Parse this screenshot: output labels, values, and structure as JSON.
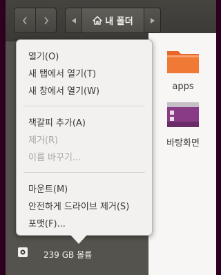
{
  "toolbar": {
    "back_icon": "chevron-left",
    "forward_icon": "chevron-right",
    "path_prev_icon": "triangle-left",
    "path_next_icon": "triangle-right",
    "home_icon": "home",
    "current_folder": "내 폴더"
  },
  "context_menu": {
    "group1": [
      {
        "label": "열기(O)",
        "enabled": true
      },
      {
        "label": "새 탭에서 열기(T)",
        "enabled": true
      },
      {
        "label": "새 창에서 열기(W)",
        "enabled": true
      }
    ],
    "group2": [
      {
        "label": "책갈피 추가(A)",
        "enabled": true
      },
      {
        "label": "제거(R)",
        "enabled": false
      },
      {
        "label": "이름 바꾸기...",
        "enabled": false
      }
    ],
    "group3": [
      {
        "label": "마운트(M)",
        "enabled": true
      },
      {
        "label": "안전하게 드라이브 제거(S)",
        "enabled": true
      },
      {
        "label": "포맷(F)...",
        "enabled": true
      }
    ]
  },
  "sidebar": {
    "volume_label": "239 GB 볼륨",
    "volume_icon": "drive-icon"
  },
  "files": [
    {
      "name": "apps",
      "icon": "folder-icon",
      "color": "#e8662c"
    },
    {
      "name": "바탕화면",
      "icon": "desktop-folder-icon",
      "color": "#8a3b85"
    }
  ]
}
